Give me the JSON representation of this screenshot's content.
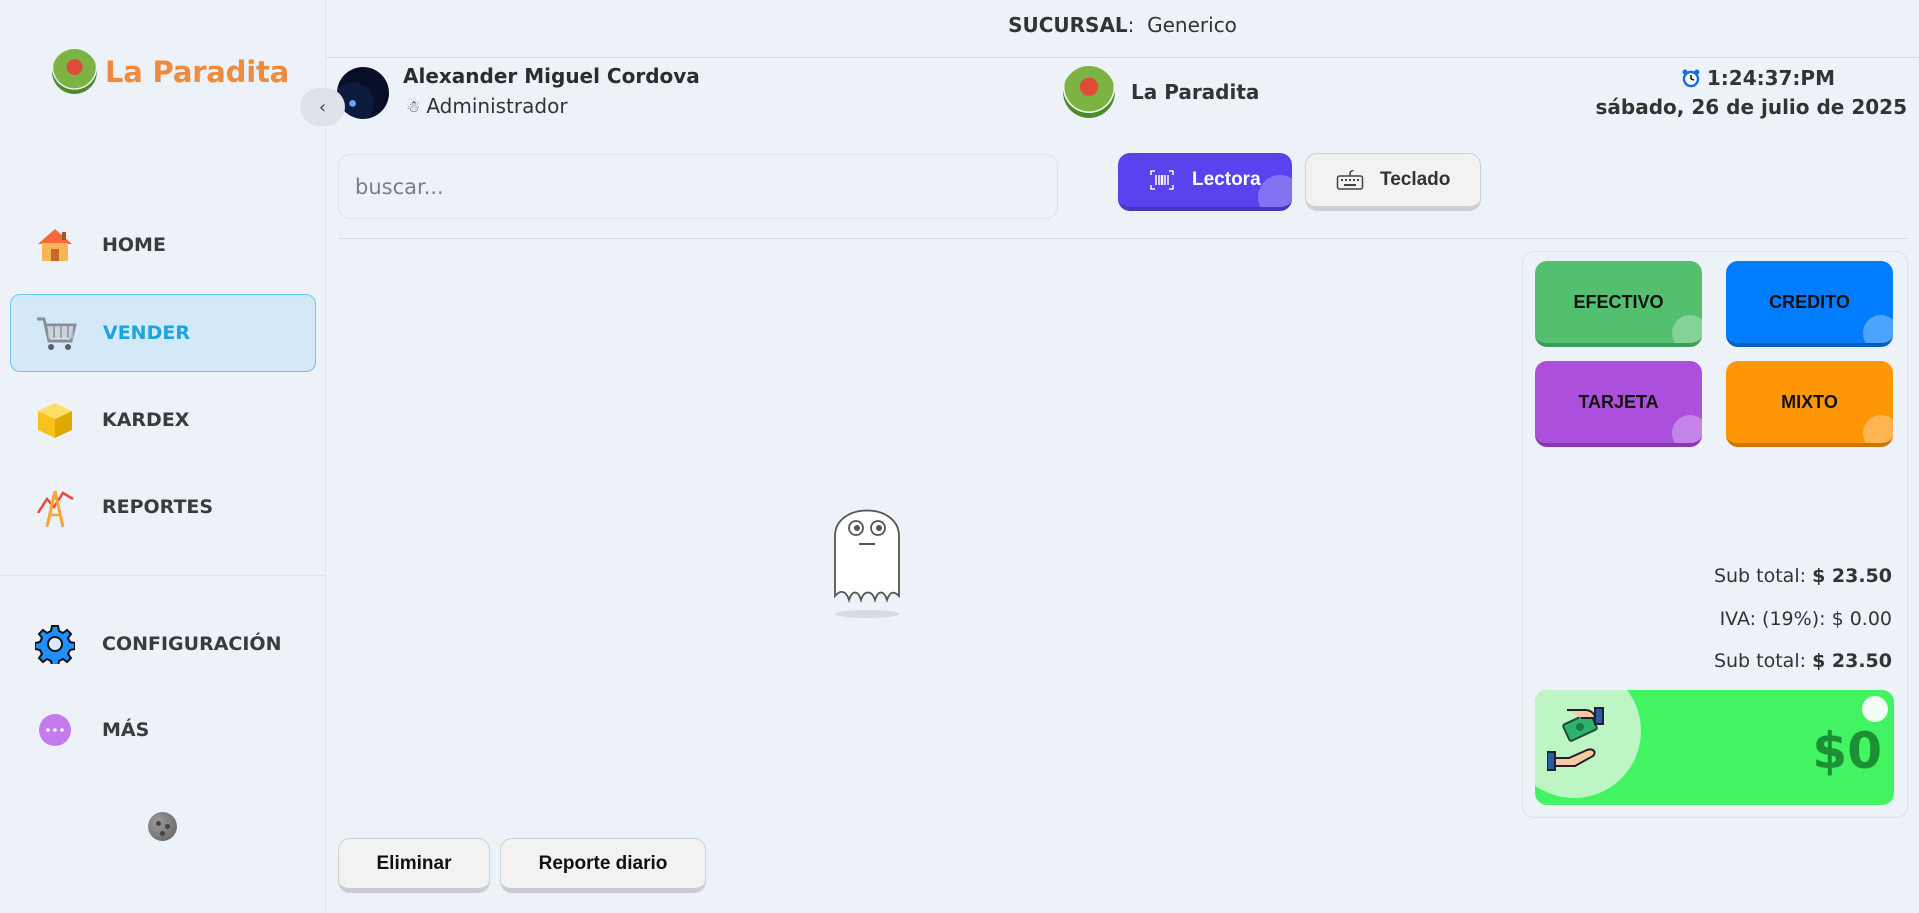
{
  "branch": {
    "label": "SUCURSAL",
    "value": "Generico"
  },
  "brand": {
    "name": "La Paradita"
  },
  "sidebar": {
    "items": [
      {
        "label": "HOME",
        "icon": "house-icon"
      },
      {
        "label": "VENDER",
        "icon": "cart-icon",
        "active": true
      },
      {
        "label": "KARDEX",
        "icon": "box-icon"
      },
      {
        "label": "REPORTES",
        "icon": "chart-icon"
      },
      {
        "label": "CONFIGURACIÓN",
        "icon": "gear-icon"
      },
      {
        "label": "MÁS",
        "icon": "more-icon"
      }
    ]
  },
  "user": {
    "name": "Alexander Miguel Cordova",
    "role": "Administrador"
  },
  "store": {
    "name": "La Paradita"
  },
  "clock": {
    "time": "1:24:37:PM",
    "date": "sábado, 26 de julio de 2025"
  },
  "search": {
    "placeholder": "buscar..."
  },
  "modes": {
    "reader": "Lectora",
    "keyboard": "Teclado"
  },
  "payment": {
    "cash": "EFECTIVO",
    "credit": "CREDITO",
    "card": "TARJETA",
    "mixed": "MIXTO"
  },
  "totals": {
    "subtotal_label": "Sub total:",
    "subtotal_value": "$ 23.50",
    "iva_label": "IVA: (19%):",
    "iva_value": "$ 0.00",
    "subtotal2_label": "Sub total:",
    "subtotal2_value": "$ 23.50",
    "grand_total": "$0"
  },
  "footer": {
    "delete": "Eliminar",
    "daily_report": "Reporte diario"
  },
  "colors": {
    "brand_orange": "#f08a3c",
    "active_nav": "#1da3e0",
    "reader_button": "#5a43ee",
    "cash": "#52c06f",
    "credit": "#007dfe",
    "card": "#ad4fdd",
    "mixed": "#fe9606",
    "total_card": "#42f362"
  }
}
